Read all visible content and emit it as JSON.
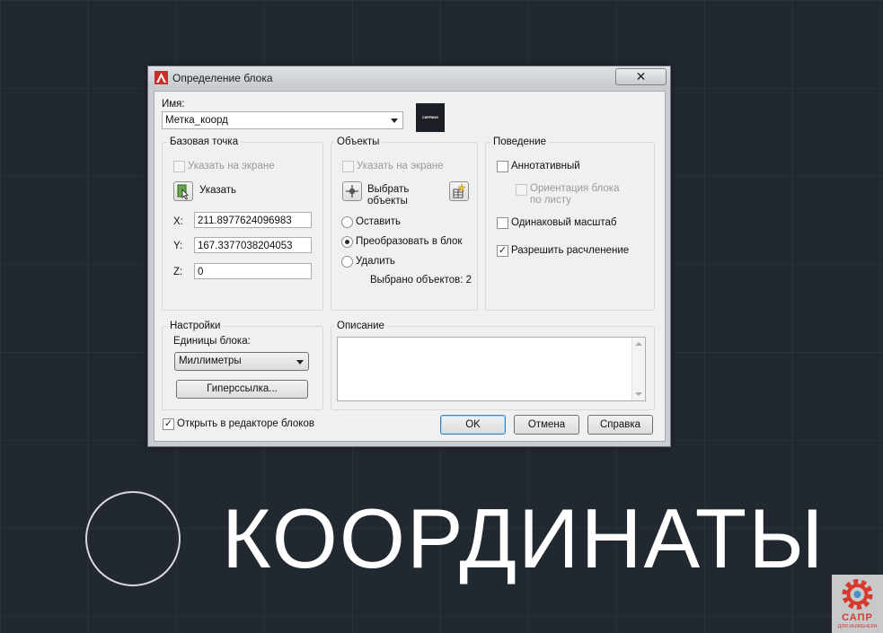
{
  "dialog": {
    "title": "Определение блока",
    "close_label": "✕",
    "name_label": "Имя:",
    "name_value": "Метка_коорд",
    "preview_text": "CSPRING"
  },
  "base_point": {
    "title": "Базовая точка",
    "specify_on_screen": "Указать на экране",
    "pick_label": "Указать",
    "x_label": "X:",
    "x_value": "211.8977624096983",
    "y_label": "Y:",
    "y_value": "167.3377038204053",
    "z_label": "Z:",
    "z_value": "0"
  },
  "objects": {
    "title": "Объекты",
    "specify_on_screen": "Указать на экране",
    "select_line1": "Выбрать",
    "select_line2": "объекты",
    "retain": "Оставить",
    "convert": "Преобразовать в блок",
    "delete": "Удалить",
    "selected_count": "Выбрано объектов: 2"
  },
  "behavior": {
    "title": "Поведение",
    "annotative": "Аннотативный",
    "orient_line1": "Ориентация блока",
    "orient_line2": "по листу",
    "uniform_scale": "Одинаковый масштаб",
    "allow_explode": "Разрешить расчленение"
  },
  "settings": {
    "title": "Настройки",
    "units_label": "Единицы блока:",
    "units_value": "Миллиметры",
    "hyperlink": "Гиперссылка..."
  },
  "description": {
    "title": "Описание",
    "value": ""
  },
  "footer": {
    "open_in_editor": "Открыть в редакторе блоков",
    "ok": "OK",
    "cancel": "Отмена",
    "help": "Справка"
  },
  "canvas": {
    "big_text": "КООРДИНАТЫ",
    "watermark_top": "САПР",
    "watermark_bottom": "ДЛЯ ИНЖЕНЕРА"
  },
  "colors": {
    "canvas_bg": "#212830",
    "autocad_red": "#d02a2a",
    "watermark_red": "#d63a2f"
  }
}
